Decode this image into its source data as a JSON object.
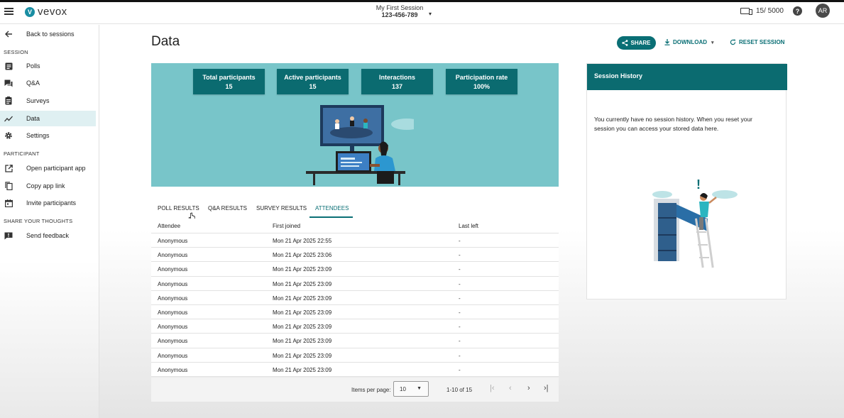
{
  "app": {
    "logo_text": "vevox",
    "logo_mark": "V"
  },
  "header": {
    "session_name": "My First Session",
    "session_code": "123-456-789",
    "participants_count": "15/ 5000",
    "avatar_initials": "AR"
  },
  "sidebar": {
    "back_label": "Back to sessions",
    "section_session": "SESSION",
    "items": [
      {
        "label": "Polls",
        "icon": "polls-icon"
      },
      {
        "label": "Q&A",
        "icon": "qa-icon"
      },
      {
        "label": "Surveys",
        "icon": "surveys-icon"
      },
      {
        "label": "Data",
        "icon": "chart-line-icon"
      },
      {
        "label": "Settings",
        "icon": "gear-icon"
      }
    ],
    "section_participant": "PARTICIPANT",
    "participant_items": [
      {
        "label": "Open participant app",
        "icon": "external-link-icon"
      },
      {
        "label": "Copy app link",
        "icon": "copy-icon"
      },
      {
        "label": "Invite participants",
        "icon": "calendar-icon"
      }
    ],
    "section_thoughts": "SHARE YOUR THOUGHTS",
    "feedback_label": "Send feedback"
  },
  "main": {
    "title": "Data",
    "share_label": "SHARE",
    "download_label": "DOWNLOAD",
    "reset_label": "RESET SESSION",
    "stats": [
      {
        "label": "Total participants",
        "value": "15"
      },
      {
        "label": "Active participants",
        "value": "15"
      },
      {
        "label": "Interactions",
        "value": "137"
      },
      {
        "label": "Participation rate",
        "value": "100%"
      }
    ],
    "tabs": [
      "POLL RESULTS",
      "Q&A RESULTS",
      "SURVEY RESULTS",
      "ATTENDEES"
    ],
    "active_tab": "ATTENDEES",
    "table": {
      "headers": [
        "Attendee",
        "First joined",
        "Last left"
      ],
      "rows": [
        [
          "Anonymous",
          "Mon 21 Apr 2025 22:55",
          "-"
        ],
        [
          "Anonymous",
          "Mon 21 Apr 2025 23:06",
          "-"
        ],
        [
          "Anonymous",
          "Mon 21 Apr 2025 23:09",
          "-"
        ],
        [
          "Anonymous",
          "Mon 21 Apr 2025 23:09",
          "-"
        ],
        [
          "Anonymous",
          "Mon 21 Apr 2025 23:09",
          "-"
        ],
        [
          "Anonymous",
          "Mon 21 Apr 2025 23:09",
          "-"
        ],
        [
          "Anonymous",
          "Mon 21 Apr 2025 23:09",
          "-"
        ],
        [
          "Anonymous",
          "Mon 21 Apr 2025 23:09",
          "-"
        ],
        [
          "Anonymous",
          "Mon 21 Apr 2025 23:09",
          "-"
        ],
        [
          "Anonymous",
          "Mon 21 Apr 2025 23:09",
          "-"
        ]
      ]
    },
    "pager": {
      "items_per_page_label": "Items per page:",
      "items_per_page": "10",
      "range": "1-10 of 15"
    }
  },
  "history": {
    "title": "Session History",
    "text": "You currently have no session history. When you reset your session you can access your stored data here."
  },
  "colors": {
    "accent": "#0a6f75",
    "hero_bg": "#78c5c9",
    "active_nav": "#dff0f2"
  }
}
